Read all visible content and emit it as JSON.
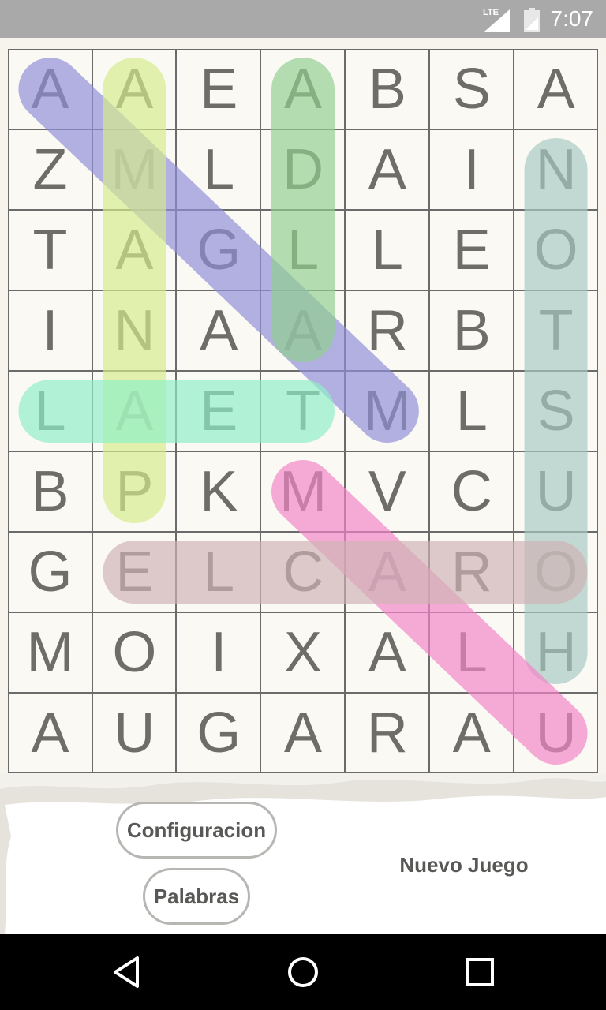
{
  "status_bar": {
    "network": "LTE",
    "time": "7:07",
    "icons": [
      "signal-icon",
      "battery-icon"
    ]
  },
  "board": {
    "rows": [
      [
        "A",
        "A",
        "E",
        "A",
        "B",
        "S",
        "A"
      ],
      [
        "Z",
        "M",
        "L",
        "D",
        "A",
        "I",
        "N"
      ],
      [
        "T",
        "A",
        "G",
        "L",
        "L",
        "E",
        "O"
      ],
      [
        "I",
        "N",
        "A",
        "A",
        "R",
        "B",
        "T"
      ],
      [
        "L",
        "A",
        "E",
        "T",
        "M",
        "L",
        "S"
      ],
      [
        "B",
        "P",
        "K",
        "M",
        "V",
        "C",
        "U"
      ],
      [
        "G",
        "E",
        "L",
        "C",
        "A",
        "R",
        "O"
      ],
      [
        "M",
        "O",
        "I",
        "X",
        "A",
        "L",
        "H"
      ],
      [
        "A",
        "U",
        "G",
        "A",
        "R",
        "A",
        "U"
      ]
    ],
    "found_words": [
      {
        "from": [
          0,
          0
        ],
        "to": [
          4,
          4
        ],
        "color": "#8f8fd8"
      },
      {
        "from": [
          0,
          1
        ],
        "to": [
          5,
          1
        ],
        "color": "#d7ec8e"
      },
      {
        "from": [
          0,
          3
        ],
        "to": [
          3,
          3
        ],
        "color": "#92cf90"
      },
      {
        "from": [
          1,
          6
        ],
        "to": [
          7,
          6
        ],
        "color": "#a7cbc3"
      },
      {
        "from": [
          4,
          0
        ],
        "to": [
          4,
          3
        ],
        "color": "#8ff0c8"
      },
      {
        "from": [
          5,
          3
        ],
        "to": [
          8,
          6
        ],
        "color": "#f385c9"
      },
      {
        "from": [
          6,
          1
        ],
        "to": [
          6,
          6
        ],
        "color": "#cfb3b5"
      }
    ]
  },
  "controls": {
    "config_label": "Configuracion",
    "words_label": "Palabras",
    "new_game_label": "Nuevo Juego"
  },
  "nav": {
    "icons": [
      "back-icon",
      "home-icon",
      "recents-icon"
    ]
  }
}
